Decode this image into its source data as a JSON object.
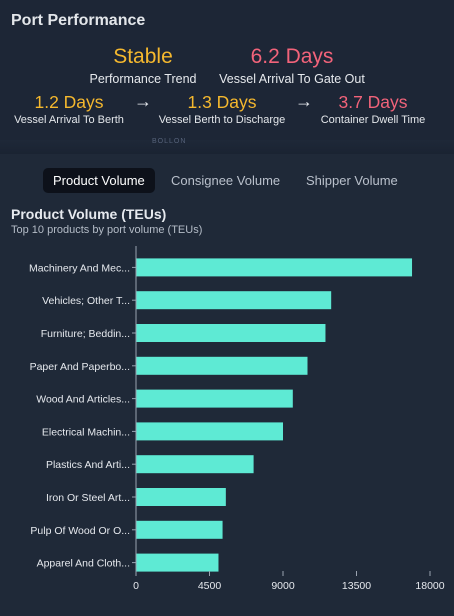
{
  "header": {
    "title": "Port Performance",
    "trend": {
      "value": "Stable",
      "label": "Performance Trend",
      "color": "#f5b82e"
    },
    "gate_out": {
      "value": "6.2 Days",
      "label": "Vessel Arrival To Gate Out",
      "color": "#f2637a"
    },
    "steps": [
      {
        "value": "1.2 Days",
        "label": "Vessel Arrival To Berth",
        "color": "#f5b82e"
      },
      {
        "value": "1.3 Days",
        "label": "Vessel Berth to Discharge",
        "color": "#f5b82e"
      },
      {
        "value": "3.7 Days",
        "label": "Container Dwell Time",
        "color": "#f2637a"
      }
    ],
    "arrow": "→",
    "map_label": "BOLLON"
  },
  "tabs": [
    {
      "label": "Product Volume",
      "active": true
    },
    {
      "label": "Consignee Volume",
      "active": false
    },
    {
      "label": "Shipper Volume",
      "active": false
    }
  ],
  "chart_data": {
    "type": "bar",
    "orientation": "horizontal",
    "title": "Product Volume (TEUs)",
    "subtitle": "Top 10 products by port volume (TEUs)",
    "categories": [
      "Machinery And Mec...",
      "Vehicles; Other T...",
      "Furniture; Beddin...",
      "Paper And Paperbo...",
      "Wood And Articles...",
      "Electrical Machin...",
      "Plastics And Arti...",
      "Iron Or Steel Art...",
      "Pulp Of Wood Or O...",
      "Apparel And Cloth..."
    ],
    "values": [
      16900,
      11950,
      11600,
      10500,
      9600,
      9000,
      7200,
      5500,
      5300,
      5050
    ],
    "xlim": [
      0,
      18000
    ],
    "xticks": [
      "0",
      "4500",
      "9000",
      "13500",
      "18000"
    ],
    "bar_color": "#5eead4",
    "grid": false
  }
}
